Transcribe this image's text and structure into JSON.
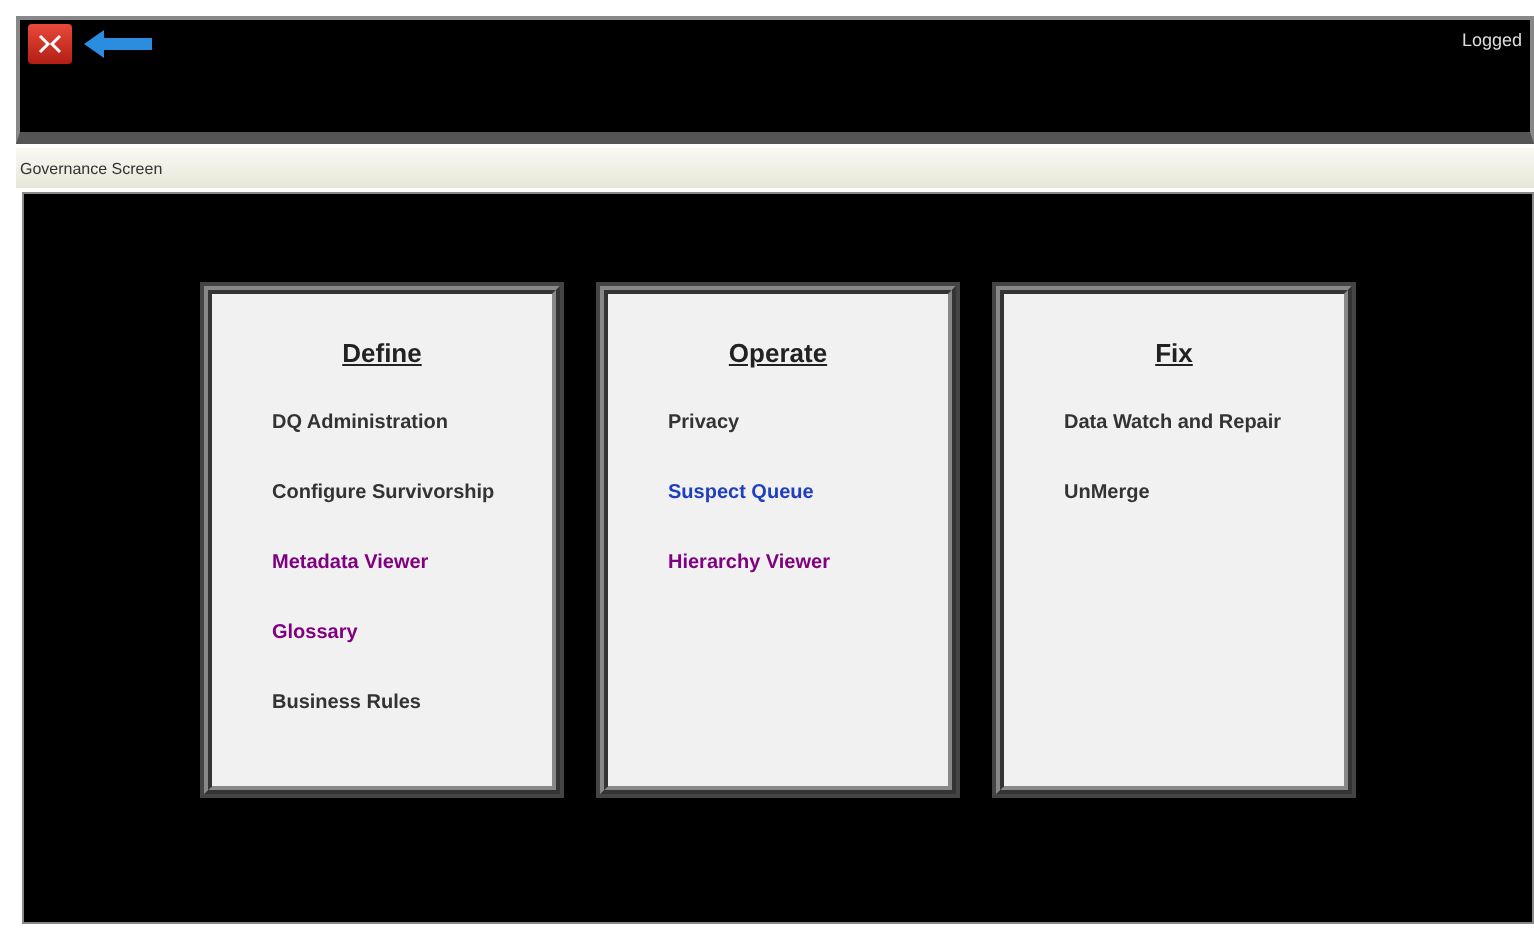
{
  "header": {
    "user_label": "Logged"
  },
  "screen_title": "Governance Screen",
  "panels": [
    {
      "title": "Define",
      "links": [
        {
          "label": "DQ Administration",
          "color": "#333333"
        },
        {
          "label": "Configure Survivorship",
          "color": "#333333"
        },
        {
          "label": "Metadata Viewer",
          "color": "#800080"
        },
        {
          "label": "Glossary",
          "color": "#800080"
        },
        {
          "label": "Business Rules",
          "color": "#333333"
        }
      ]
    },
    {
      "title": "Operate",
      "links": [
        {
          "label": "Privacy",
          "color": "#333333"
        },
        {
          "label": "Suspect Queue",
          "color": "#1f3fbf"
        },
        {
          "label": "Hierarchy Viewer",
          "color": "#800080"
        }
      ]
    },
    {
      "title": "Fix",
      "links": [
        {
          "label": "Data Watch and Repair",
          "color": "#333333"
        },
        {
          "label": "UnMerge",
          "color": "#333333"
        }
      ]
    }
  ]
}
